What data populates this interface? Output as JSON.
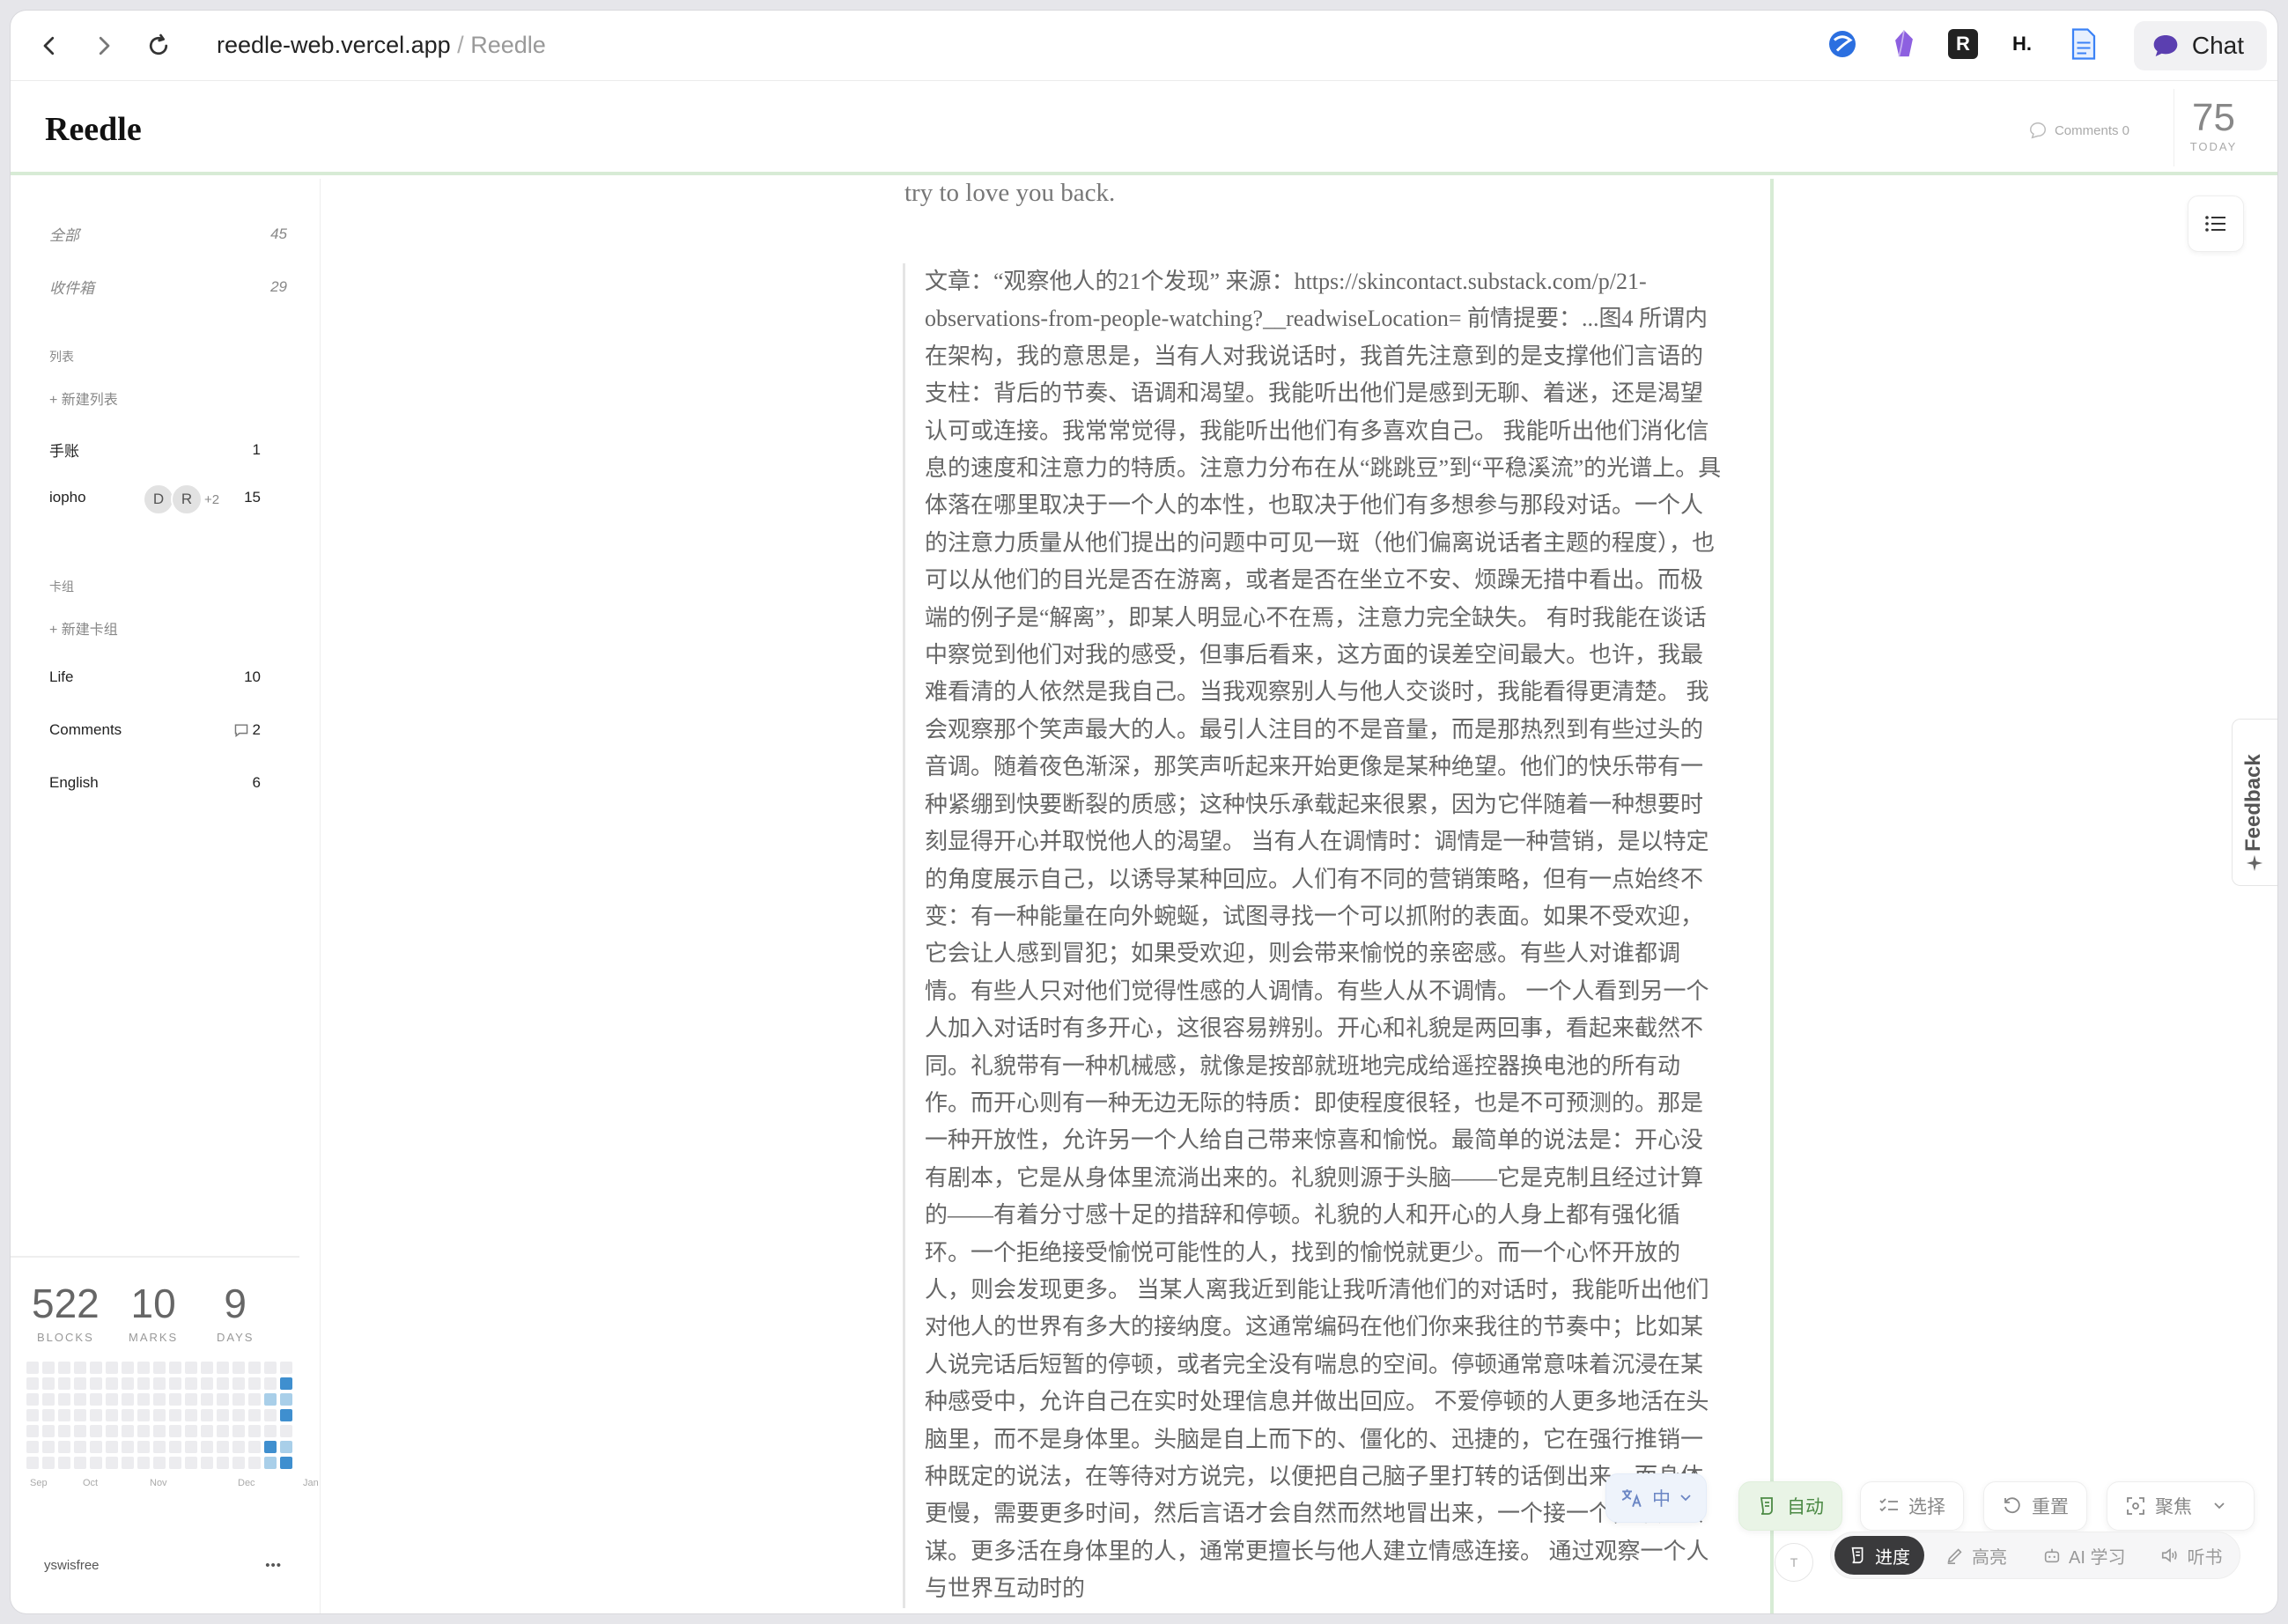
{
  "browser": {
    "url_host": "reedle-web.vercel.app",
    "url_separator": "/",
    "page_title": "Reedle",
    "chat_label": "Chat",
    "extensions": [
      {
        "name": "globe-extension-icon",
        "glyph": "",
        "color": "#2b6fe0"
      },
      {
        "name": "obsidian-extension-icon",
        "glyph": "",
        "color": "#8d60e0"
      },
      {
        "name": "readwise-extension-icon",
        "glyph": "R",
        "color": "#222222"
      },
      {
        "name": "h-extension-icon",
        "glyph": "H.",
        "color": "#111111"
      },
      {
        "name": "doc-extension-icon",
        "glyph": "",
        "color": "#3b82f6"
      }
    ]
  },
  "app": {
    "logo": "Reedle",
    "comments_label": "Comments 0",
    "today_count": "75",
    "today_label": "TODAY"
  },
  "sidebar": {
    "all": {
      "label": "全部",
      "count": "45"
    },
    "inbox": {
      "label": "收件箱",
      "count": "29"
    },
    "lists_header": "列表",
    "new_list": "+ 新建列表",
    "lists": [
      {
        "label": "手账",
        "count": "1"
      },
      {
        "label": "iopho",
        "count": "15",
        "avatars": [
          "D",
          "R"
        ],
        "more": "+2"
      }
    ],
    "decks_header": "卡组",
    "new_deck": "+ 新建卡组",
    "decks": [
      {
        "label": "Life",
        "count": "10"
      },
      {
        "label": "Comments",
        "count": "2"
      },
      {
        "label": "English",
        "count": "6"
      }
    ],
    "stats": [
      {
        "value": "522",
        "label": "BLOCKS"
      },
      {
        "value": "10",
        "label": "MARKS"
      },
      {
        "value": "9",
        "label": "DAYS"
      }
    ],
    "months": [
      "Sep",
      "Oct",
      "Nov",
      "Dec",
      "Jan"
    ],
    "username": "yswisfree",
    "more_label": "•••"
  },
  "article": {
    "prev_line": "try to love you back.",
    "quote": "文章：“观察他人的21个发现” 来源：https://skincontact.substack.com/p/21-observations-from-people-watching?__readwiseLocation= 前情提要：...图4 所谓内在架构，我的意思是，当有人对我说话时，我首先注意到的是支撑他们言语的支柱：背后的节奏、语调和渴望。我能听出他们是感到无聊、着迷，还是渴望认可或连接。我常常觉得，我能听出他们有多喜欢自己。 我能听出他们消化信息的速度和注意力的特质。注意力分布在从“跳跳豆”到“平稳溪流”的光谱上。具体落在哪里取决于一个人的本性，也取决于他们有多想参与那段对话。一个人的注意力质量从他们提出的问题中可见一斑（他们偏离说话者主题的程度），也可以从他们的目光是否在游离，或者是否在坐立不安、烦躁无措中看出。而极端的例子是“解离”，即某人明显心不在焉，注意力完全缺失。 有时我能在谈话中察觉到他们对我的感受，但事后看来，这方面的误差空间最大。也许，我最难看清的人依然是我自己。当我观察别人与他人交谈时，我能看得更清楚。 我会观察那个笑声最大的人。最引人注目的不是音量，而是那热烈到有些过头的音调。随着夜色渐深，那笑声听起来开始更像是某种绝望。他们的快乐带有一种紧绷到快要断裂的质感；这种快乐承载起来很累，因为它伴随着一种想要时刻显得开心并取悦他人的渴望。 当有人在调情时：调情是一种营销，是以特定的角度展示自己，以诱导某种回应。人们有不同的营销策略，但有一点始终不变：有一种能量在向外蜿蜒，试图寻找一个可以抓附的表面。如果不受欢迎，它会让人感到冒犯；如果受欢迎，则会带来愉悦的亲密感。有些人对谁都调情。有些人只对他们觉得性感的人调情。有些人从不调情。 一个人看到另一个人加入对话时有多开心，这很容易辨别。开心和礼貌是两回事，看起来截然不同。礼貌带有一种机械感，就像是按部就班地完成给遥控器换电池的所有动作。而开心则有一种无边无际的特质：即使程度很轻，也是不可预测的。那是一种开放性，允许另一个人给自己带来惊喜和愉悦。最简单的说法是：开心没有剧本，它是从身体里流淌出来的。礼貌则源于头脑——它是克制且经过计算的——有着分寸感十足的措辞和停顿。礼貌的人和开心的人身上都有强化循环。一个拒绝接受愉悦可能性的人，找到的愉悦就更少。而一个心怀开放的人，则会发现更多。 当某人离我近到能让我听清他们的对话时，我能听出他们对他人的世界有多大的接纳度。这通常编码在他们你来我往的节奏中；比如某人说完话后短暂的停顿，或者完全没有喘息的空间。停顿通常意味着沉浸在某种感受中，允许自己在实时处理信息并做出回应。 不爱停顿的人更多地活在头脑里，而不是身体里。头脑是自上而下的、僵化的、迅捷的，它在强行推销一种既定的说法，在等待对方说完，以便把自己脑子里打转的话倒出来。而身体更慢，需要更多时间，然后言语才会自然而然地冒出来，一个接一个，不加预谋。更多活在身体里的人，通常更擅长与他人建立情感连接。 通过观察一个人与世界互动时的"
  },
  "toolbar": {
    "lang": "中",
    "auto": "自动",
    "select": "选择",
    "reset": "重置",
    "focus": "聚焦",
    "t_label": "T",
    "progress": "进度",
    "highlight": "高亮",
    "ai": "AI 学习",
    "listen": "听书"
  },
  "feedback_label": "Feedback",
  "colors": {
    "accent_green": "#d7ebd5",
    "heat_dark": "#3f8fcf",
    "heat_light": "#a9cfe9",
    "heat_empty": "#ececef"
  }
}
